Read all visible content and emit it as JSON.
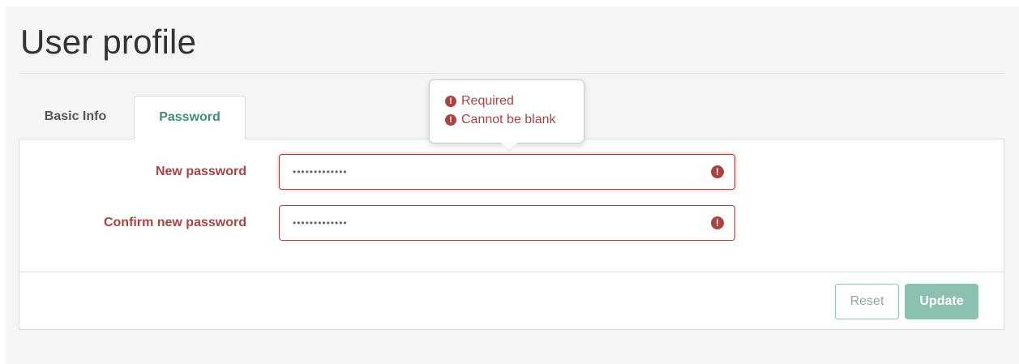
{
  "page": {
    "title": "User profile"
  },
  "tabs": [
    {
      "label": "Basic Info",
      "active": false
    },
    {
      "label": "Password",
      "active": true
    }
  ],
  "form": {
    "fields": [
      {
        "label": "New password",
        "value": "•••••••••••••",
        "type": "password",
        "state": "error",
        "icon": "exclamation-circle-icon"
      },
      {
        "label": "Confirm new password",
        "value": "•••••••••••••",
        "type": "password",
        "state": "error",
        "icon": "exclamation-circle-icon"
      }
    ]
  },
  "validation_popover": {
    "messages": [
      {
        "icon": "exclamation-circle-icon",
        "text": "Required"
      },
      {
        "icon": "exclamation-circle-icon",
        "text": "Cannot be blank"
      }
    ]
  },
  "buttons": {
    "reset_label": "Reset",
    "update_label": "Update"
  },
  "colors": {
    "error": "#a94442",
    "accent": "#3f8e78",
    "update_button": "#8cc0b1"
  }
}
